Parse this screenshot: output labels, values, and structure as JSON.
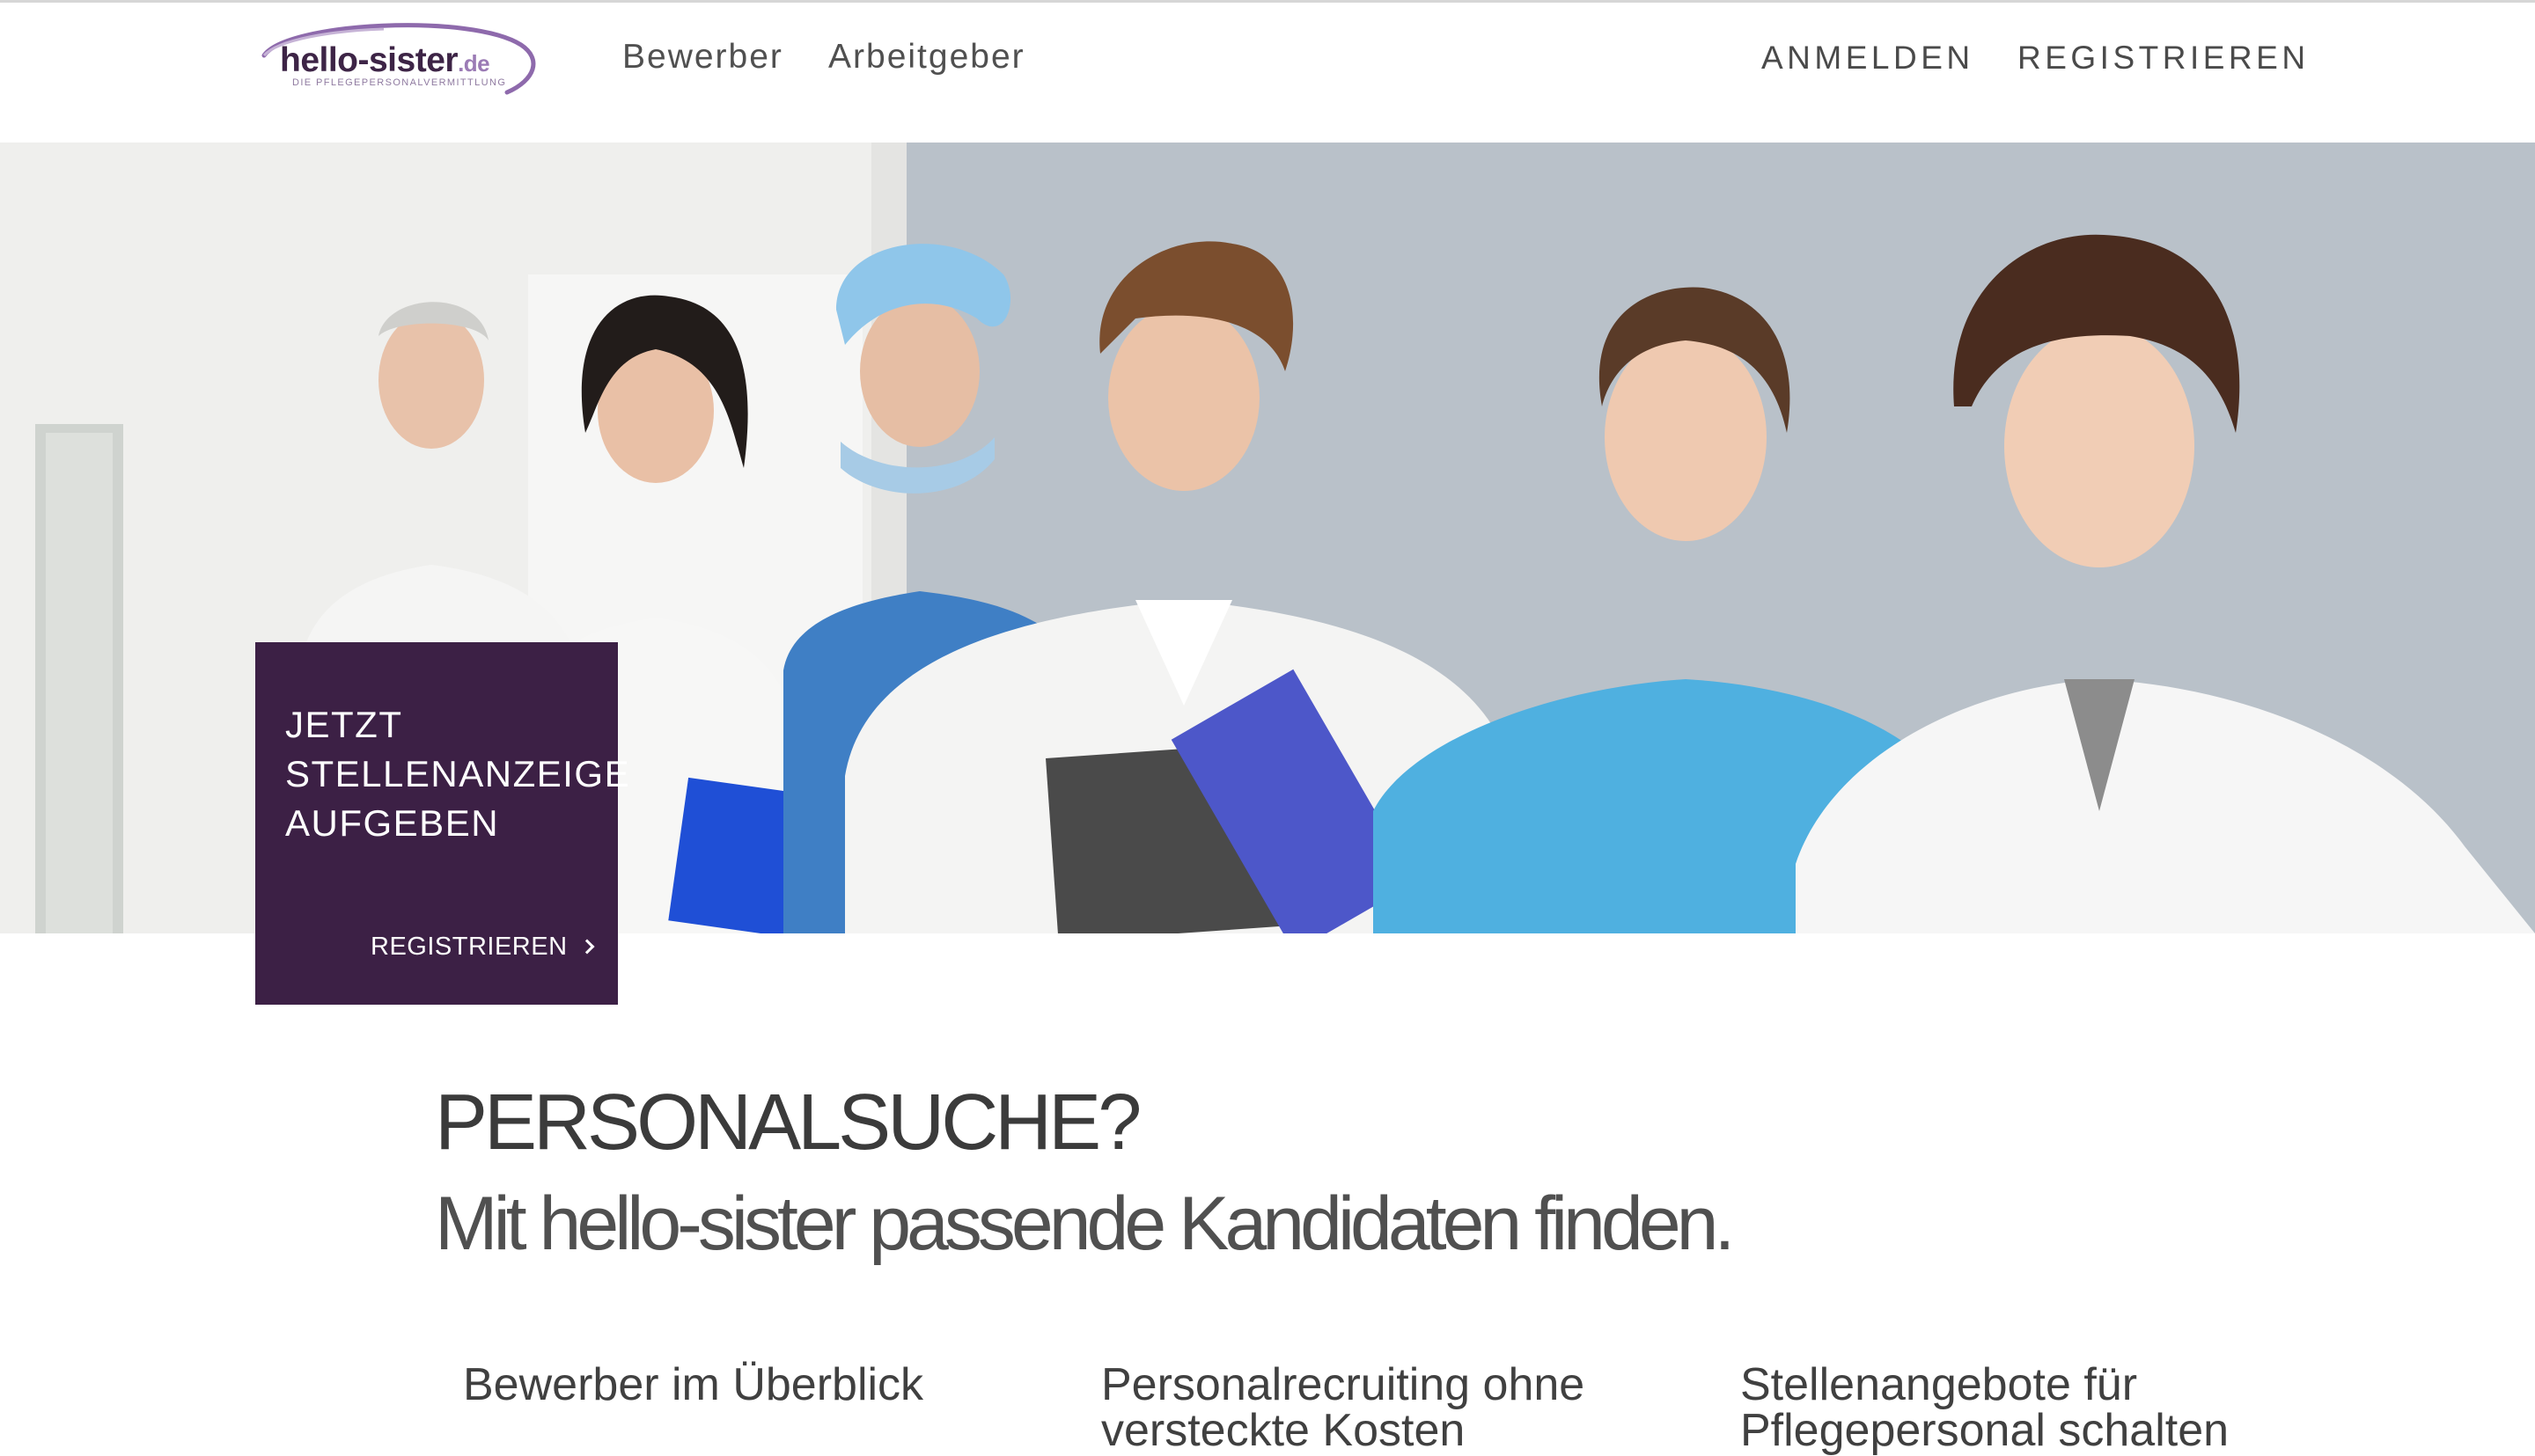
{
  "header": {
    "logo": {
      "name": "hello-sister",
      "tld": ".de",
      "tagline": "DIE PFLEGEPERSONALVERMITTLUNG"
    },
    "nav_left": [
      {
        "label": "Bewerber"
      },
      {
        "label": "Arbeitgeber"
      }
    ],
    "nav_right": [
      {
        "label": "ANMELDEN"
      },
      {
        "label": "REGISTRIEREN"
      }
    ]
  },
  "hero": {
    "image": "medical-team-photo",
    "cta": {
      "title_lines": [
        "JETZT",
        "STELLENANZEIGE",
        "AUFGEBEN"
      ],
      "link_label": "REGISTRIEREN",
      "link_icon": "chevron-right-icon"
    }
  },
  "main": {
    "heading": "PERSONALSUCHE?",
    "subheading": "Mit hello-sister passende Kandidaten finden.",
    "features": [
      {
        "lines": [
          "Bewerber im Überblick"
        ]
      },
      {
        "lines": [
          "Personalrecruiting ohne",
          "versteckte Kosten"
        ]
      },
      {
        "lines": [
          "Stellenangebote für",
          "Pflegepersonal schalten"
        ]
      }
    ]
  },
  "colors": {
    "brand_purple": "#3c2045",
    "logo_accent": "#9b7bb5",
    "text_dark": "#3b3b3b"
  }
}
